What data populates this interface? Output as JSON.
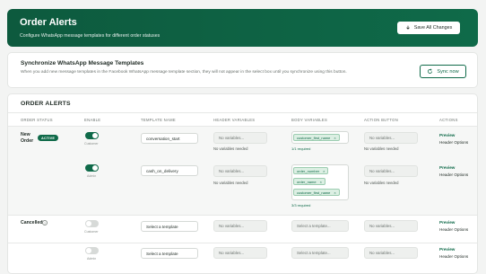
{
  "header": {
    "title": "Order Alerts",
    "subtitle": "Configure WhatsApp message templates for different order statuses",
    "save_label": "Save All Changes"
  },
  "sync": {
    "title": "Synchronize WhatsApp Message Templates",
    "description": "When you add new message templates in the Facebook WhatsApp message template section, they will not appear in the select box until you synchronize using this button.",
    "button_label": "Sync now"
  },
  "orders": {
    "title": "ORDER ALERTS",
    "columns": [
      "ORDER STATUS",
      "ENABLE",
      "TEMPLATE NAME",
      "HEADER VARIABLES",
      "BODY VARIABLES",
      "ACTION BUTTON",
      "ACTIONS"
    ],
    "rows": [
      {
        "status": "New Order",
        "badge": "ACTIVE",
        "enabled": true,
        "toggle_label": "Customer",
        "template": "conversation_start",
        "header_placeholder": "No variables...",
        "header_note": "No variables needed",
        "body_chips": [
          "customer_first_name"
        ],
        "body_required": "1/1 required",
        "action_placeholder": "No variables...",
        "action_note": "No variables needed",
        "preview": "Preview",
        "header_options": "Header Options"
      },
      {
        "enabled": true,
        "toggle_label": "Admin",
        "template": "cash_on_delivery",
        "header_placeholder": "No variables...",
        "header_note": "No variables needed",
        "body_chips": [
          "order_number",
          "order_name",
          "customer_first_name"
        ],
        "body_required": "3/3 required",
        "action_placeholder": "No variables...",
        "action_note": "No variables needed",
        "preview": "Preview",
        "header_options": "Header Options"
      },
      {
        "status": "Cancelled",
        "help": "?",
        "enabled": false,
        "toggle_label": "Customer",
        "template": "Select a template",
        "header_placeholder": "No variables...",
        "body_placeholder": "Select a template...",
        "action_placeholder": "No variables...",
        "preview": "Preview",
        "header_options": "Header Options"
      },
      {
        "enabled": false,
        "toggle_label": "Admin",
        "template": "Select a template",
        "header_placeholder": "No variables...",
        "body_placeholder": "Select a template...",
        "action_placeholder": "No variables...",
        "preview": "Preview",
        "header_options": "Header Options"
      }
    ]
  },
  "colors": {
    "brand": "#0f6a49",
    "chip_bg": "#dcefe3",
    "toggle_off": "#d7dad8"
  }
}
